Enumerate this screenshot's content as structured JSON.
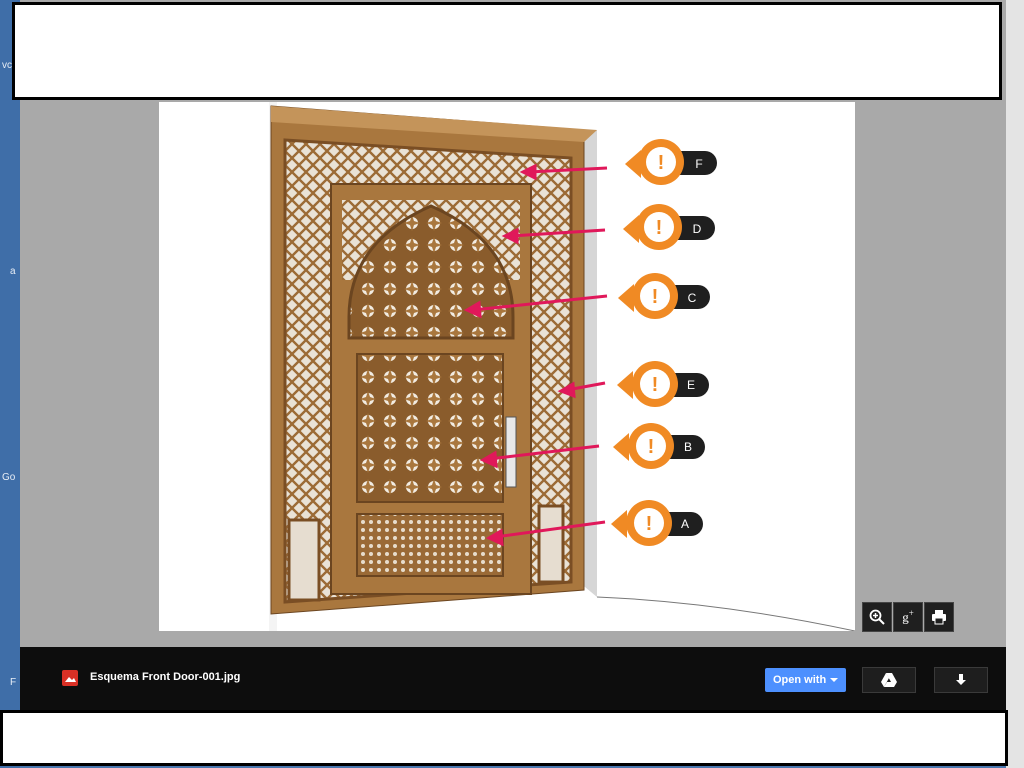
{
  "background_edge": {
    "texts": [
      "vc",
      "a",
      "Go",
      "F"
    ]
  },
  "file": {
    "name": "Esquema Front Door-001.jpg"
  },
  "actions": {
    "open_with": "Open with"
  },
  "image": {
    "callouts": [
      "F",
      "D",
      "C",
      "E",
      "B",
      "A"
    ]
  },
  "colors": {
    "callout_orange": "#f08a24",
    "arrow_pink": "#e0185a",
    "wood": "#a9773e",
    "accent_blue": "#4d90fe"
  },
  "icons": [
    "zoom-in-icon",
    "google-plus-icon",
    "print-icon",
    "drive-icon",
    "download-icon",
    "image-file-icon"
  ]
}
